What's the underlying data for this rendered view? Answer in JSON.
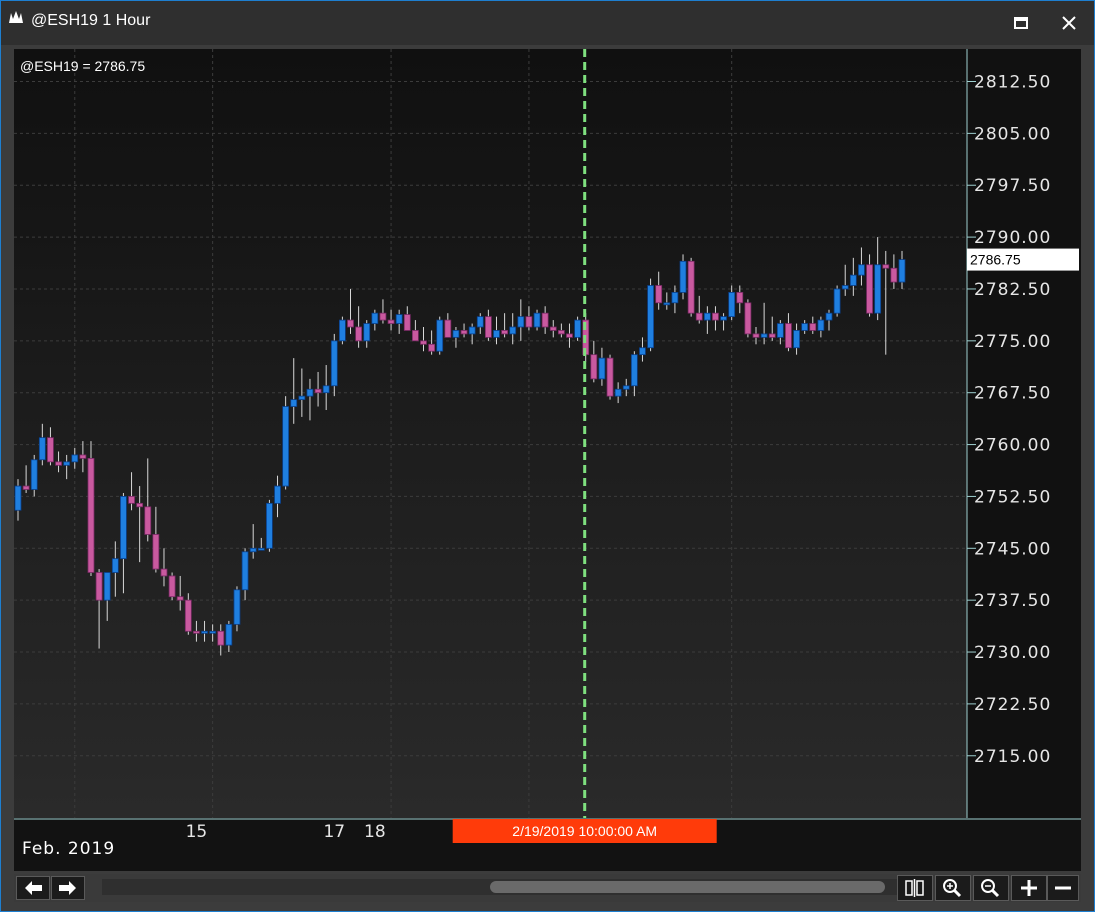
{
  "window": {
    "title": "@ESH19 1 Hour",
    "maximize_icon": "maximize-icon",
    "close_icon": "close-icon",
    "app_icon": "app-logo-icon"
  },
  "colors": {
    "background": "#101010",
    "grid": "#3c3c3c",
    "bull_body": "#1f7fe0",
    "bear_body": "#c9599f",
    "wick": "#d8d8d8",
    "cursor_line": "#7fe07f",
    "cursor_label_bg": "#ff3b0a",
    "axis_text": "#e6e6e6",
    "price_marker_bg": "#ffffff"
  },
  "chart_data": {
    "type": "candlestick",
    "symbol_label": "@ESH19 = 2786.75",
    "last_price": 2786.75,
    "last_price_label": "2786.75",
    "cursor_label": "2/19/2019 10:00:00 AM",
    "cursor_index": 70,
    "y_ticks": [
      2812.5,
      2805.0,
      2797.5,
      2790.0,
      2782.5,
      2775.0,
      2767.5,
      2760.0,
      2752.5,
      2745.0,
      2737.5,
      2730.0,
      2722.5,
      2715.0
    ],
    "y_tick_labels": [
      "2812.50",
      "2805.00",
      "2797.50",
      "2790.00",
      "2782.50",
      "2775.00",
      "2767.50",
      "2760.00",
      "2752.50",
      "2745.00",
      "2737.50",
      "2730.00",
      "2722.50",
      "2715.00"
    ],
    "ylim": [
      2706.0,
      2817.2
    ],
    "x_labels": [
      {
        "label": "15",
        "index": 22
      },
      {
        "label": "17",
        "index": 39
      },
      {
        "label": "18",
        "index": 44
      }
    ],
    "period_label": "Feb. 2019",
    "candles": [
      [
        2750.5,
        2755.0,
        2749.0,
        2754.0
      ],
      [
        2754.0,
        2757.0,
        2753.0,
        2753.5
      ],
      [
        2753.5,
        2758.5,
        2752.5,
        2757.8
      ],
      [
        2757.8,
        2763.0,
        2757.0,
        2761.0
      ],
      [
        2761.0,
        2762.5,
        2757.0,
        2757.5
      ],
      [
        2757.5,
        2759.0,
        2756.0,
        2757.0
      ],
      [
        2757.0,
        2758.5,
        2755.0,
        2757.5
      ],
      [
        2757.5,
        2759.5,
        2756.5,
        2758.5
      ],
      [
        2758.5,
        2760.5,
        2756.0,
        2758.0
      ],
      [
        2758.0,
        2760.5,
        2741.0,
        2741.5
      ],
      [
        2741.5,
        2742.0,
        2730.5,
        2737.5
      ],
      [
        2737.5,
        2741.5,
        2734.5,
        2741.5
      ],
      [
        2741.5,
        2746.0,
        2738.0,
        2743.5
      ],
      [
        2743.5,
        2753.0,
        2738.5,
        2752.5
      ],
      [
        2752.5,
        2756.0,
        2750.5,
        2751.5
      ],
      [
        2751.5,
        2754.0,
        2743.0,
        2751.0
      ],
      [
        2751.0,
        2758.0,
        2746.0,
        2747.0
      ],
      [
        2747.0,
        2751.0,
        2741.5,
        2742.0
      ],
      [
        2742.0,
        2745.0,
        2739.5,
        2741.0
      ],
      [
        2741.0,
        2741.5,
        2737.5,
        2738.0
      ],
      [
        2738.0,
        2741.0,
        2736.0,
        2737.5
      ],
      [
        2737.5,
        2738.5,
        2732.5,
        2733.0
      ],
      [
        2733.0,
        2734.5,
        2731.5,
        2732.8
      ],
      [
        2732.8,
        2734.5,
        2731.5,
        2733.0
      ],
      [
        2733.0,
        2734.0,
        2731.5,
        2733.0
      ],
      [
        2733.0,
        2734.0,
        2729.5,
        2731.0
      ],
      [
        2731.0,
        2734.5,
        2730.0,
        2734.0
      ],
      [
        2734.0,
        2739.5,
        2733.0,
        2739.0
      ],
      [
        2739.0,
        2745.0,
        2737.5,
        2744.5
      ],
      [
        2744.5,
        2748.5,
        2743.5,
        2745.0
      ],
      [
        2745.0,
        2746.5,
        2745.0,
        2745.0
      ],
      [
        2745.0,
        2752.0,
        2744.5,
        2751.5
      ],
      [
        2751.5,
        2755.5,
        2749.5,
        2754.0
      ],
      [
        2754.0,
        2767.0,
        2753.5,
        2765.5
      ],
      [
        2765.5,
        2772.5,
        2763.0,
        2766.5
      ],
      [
        2766.5,
        2771.0,
        2764.0,
        2767.0
      ],
      [
        2767.0,
        2769.5,
        2763.5,
        2768.0
      ],
      [
        2768.0,
        2770.5,
        2765.5,
        2767.5
      ],
      [
        2767.5,
        2771.5,
        2765.0,
        2768.5
      ],
      [
        2768.5,
        2776.0,
        2767.0,
        2775.0
      ],
      [
        2775.0,
        2778.5,
        2774.5,
        2778.0
      ],
      [
        2778.0,
        2782.5,
        2776.0,
        2777.0
      ],
      [
        2777.0,
        2780.0,
        2774.0,
        2775.0
      ],
      [
        2775.0,
        2778.0,
        2774.0,
        2777.5
      ],
      [
        2777.5,
        2779.5,
        2776.5,
        2779.0
      ],
      [
        2779.0,
        2781.0,
        2777.5,
        2778.0
      ],
      [
        2778.0,
        2779.5,
        2776.5,
        2777.5
      ],
      [
        2777.5,
        2779.5,
        2776.0,
        2778.8
      ],
      [
        2778.8,
        2780.0,
        2777.0,
        2776.5
      ],
      [
        2776.5,
        2778.0,
        2775.0,
        2775.0
      ],
      [
        2775.0,
        2777.0,
        2773.5,
        2774.5
      ],
      [
        2774.5,
        2776.5,
        2773.0,
        2773.5
      ],
      [
        2773.5,
        2778.5,
        2773.0,
        2778.0
      ],
      [
        2778.0,
        2779.0,
        2775.5,
        2775.5
      ],
      [
        2775.5,
        2777.0,
        2774.0,
        2776.5
      ],
      [
        2776.5,
        2777.5,
        2775.5,
        2776.0
      ],
      [
        2776.0,
        2777.5,
        2774.5,
        2777.0
      ],
      [
        2777.0,
        2779.0,
        2776.0,
        2778.5
      ],
      [
        2778.5,
        2779.5,
        2775.0,
        2775.5
      ],
      [
        2775.5,
        2778.5,
        2774.5,
        2776.5
      ],
      [
        2776.5,
        2779.0,
        2775.5,
        2776.0
      ],
      [
        2776.0,
        2779.0,
        2774.5,
        2777.0
      ],
      [
        2777.0,
        2781.0,
        2775.0,
        2778.5
      ],
      [
        2778.5,
        2780.0,
        2776.5,
        2777.0
      ],
      [
        2777.0,
        2779.5,
        2776.5,
        2779.0
      ],
      [
        2779.0,
        2780.0,
        2776.0,
        2777.0
      ],
      [
        2777.0,
        2778.0,
        2775.5,
        2776.5
      ],
      [
        2776.5,
        2777.5,
        2775.5,
        2776.0
      ],
      [
        2776.0,
        2777.5,
        2774.0,
        2775.5
      ],
      [
        2775.5,
        2778.5,
        2775.0,
        2778.0
      ],
      [
        2778.0,
        2779.0,
        2772.0,
        2773.0
      ],
      [
        2773.0,
        2775.0,
        2769.0,
        2769.5
      ],
      [
        2769.5,
        2774.0,
        2768.5,
        2772.5
      ],
      [
        2772.5,
        2773.0,
        2766.5,
        2767.0
      ],
      [
        2767.0,
        2769.0,
        2766.0,
        2768.0
      ],
      [
        2768.0,
        2769.5,
        2767.0,
        2768.5
      ],
      [
        2768.5,
        2773.5,
        2767.0,
        2773.0
      ],
      [
        2773.0,
        2775.5,
        2772.0,
        2774.0
      ],
      [
        2774.0,
        2784.0,
        2773.5,
        2783.0
      ],
      [
        2783.0,
        2785.0,
        2779.5,
        2780.5
      ],
      [
        2780.5,
        2782.0,
        2779.5,
        2780.5
      ],
      [
        2780.5,
        2783.0,
        2779.0,
        2782.0
      ],
      [
        2782.0,
        2787.5,
        2781.0,
        2786.5
      ],
      [
        2786.5,
        2787.0,
        2778.5,
        2779.0
      ],
      [
        2779.0,
        2781.5,
        2777.5,
        2778.0
      ],
      [
        2778.0,
        2780.0,
        2776.0,
        2779.0
      ],
      [
        2779.0,
        2780.0,
        2776.5,
        2778.0
      ],
      [
        2778.0,
        2779.0,
        2776.5,
        2778.5
      ],
      [
        2778.5,
        2783.0,
        2778.0,
        2782.0
      ],
      [
        2782.0,
        2783.0,
        2779.0,
        2780.5
      ],
      [
        2780.5,
        2781.0,
        2775.5,
        2776.0
      ],
      [
        2776.0,
        2777.0,
        2774.5,
        2775.5
      ],
      [
        2775.5,
        2780.5,
        2774.5,
        2776.0
      ],
      [
        2776.0,
        2778.5,
        2775.0,
        2775.5
      ],
      [
        2775.5,
        2778.0,
        2774.5,
        2777.5
      ],
      [
        2777.5,
        2779.0,
        2773.5,
        2774.0
      ],
      [
        2774.0,
        2777.5,
        2773.0,
        2776.5
      ],
      [
        2776.5,
        2778.0,
        2776.0,
        2777.5
      ],
      [
        2777.5,
        2778.5,
        2776.0,
        2776.5
      ],
      [
        2776.5,
        2778.5,
        2775.5,
        2778.0
      ],
      [
        2778.0,
        2779.5,
        2776.5,
        2779.0
      ],
      [
        2779.0,
        2783.0,
        2778.5,
        2782.5
      ],
      [
        2782.5,
        2786.0,
        2781.5,
        2783.0
      ],
      [
        2783.0,
        2787.0,
        2781.5,
        2784.5
      ],
      [
        2784.5,
        2788.5,
        2783.0,
        2786.0
      ],
      [
        2786.0,
        2787.5,
        2778.5,
        2779.0
      ],
      [
        2779.0,
        2790.0,
        2778.0,
        2786.0
      ],
      [
        2786.0,
        2788.0,
        2773.0,
        2785.5
      ],
      [
        2785.5,
        2787.5,
        2782.5,
        2783.5
      ],
      [
        2783.5,
        2788.0,
        2782.5,
        2786.75
      ]
    ]
  },
  "toolbar": {
    "scroll_left_icon": "arrow-left-icon",
    "scroll_right_icon": "arrow-right-icon",
    "bar_spacing_icon": "bar-spacing-icon",
    "zoom_in_icon": "zoom-in-icon",
    "zoom_out_icon": "zoom-out-icon",
    "add_icon": "plus-icon",
    "remove_icon": "minus-icon"
  }
}
